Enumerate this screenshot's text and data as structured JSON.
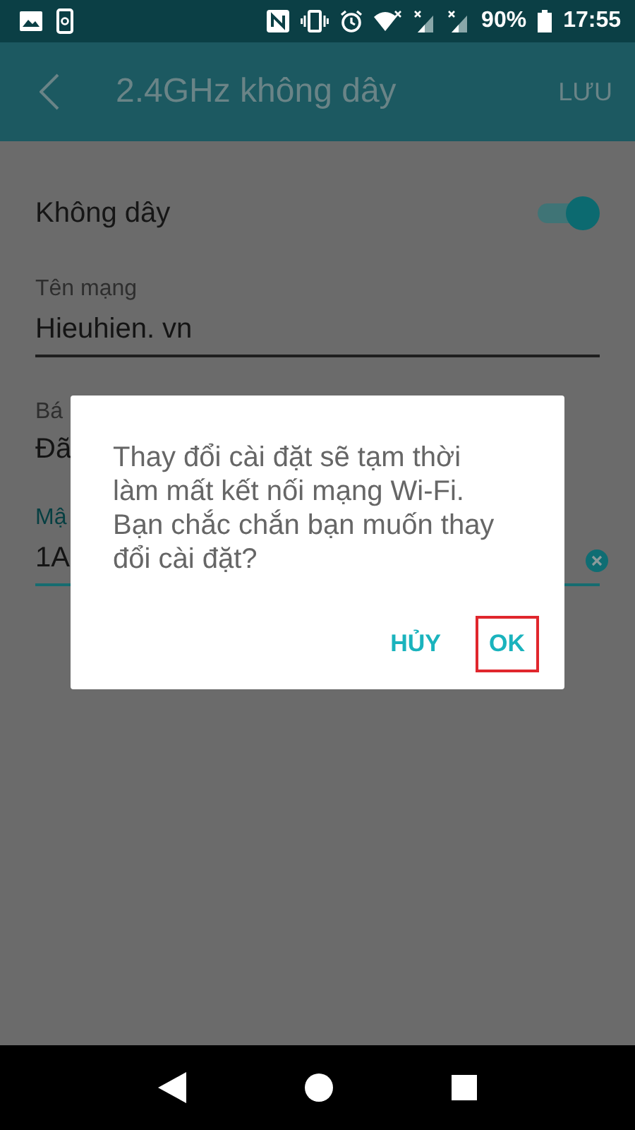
{
  "status_bar": {
    "battery": "90%",
    "time": "17:55"
  },
  "toolbar": {
    "title": "2.4GHz không dây",
    "action": "LƯU"
  },
  "settings": {
    "wireless": {
      "label": "Không dây",
      "on": true
    },
    "network_name": {
      "label": "Tên mạng",
      "value": "Hieuhien. vn"
    },
    "security": {
      "label": "Bá",
      "value": "Đã"
    },
    "password": {
      "label": "Mậ",
      "value": "1A",
      "focused": true
    }
  },
  "dialog": {
    "message": "Thay đổi cài đặt sẽ tạm thời làm mất kết nối mạng Wi-Fi. Bạn chắc chắn bạn muốn thay đổi cài đặt?",
    "buttons": [
      {
        "label": "HỦY",
        "highlighted": false
      },
      {
        "label": "OK",
        "highlighted": true
      }
    ]
  }
}
